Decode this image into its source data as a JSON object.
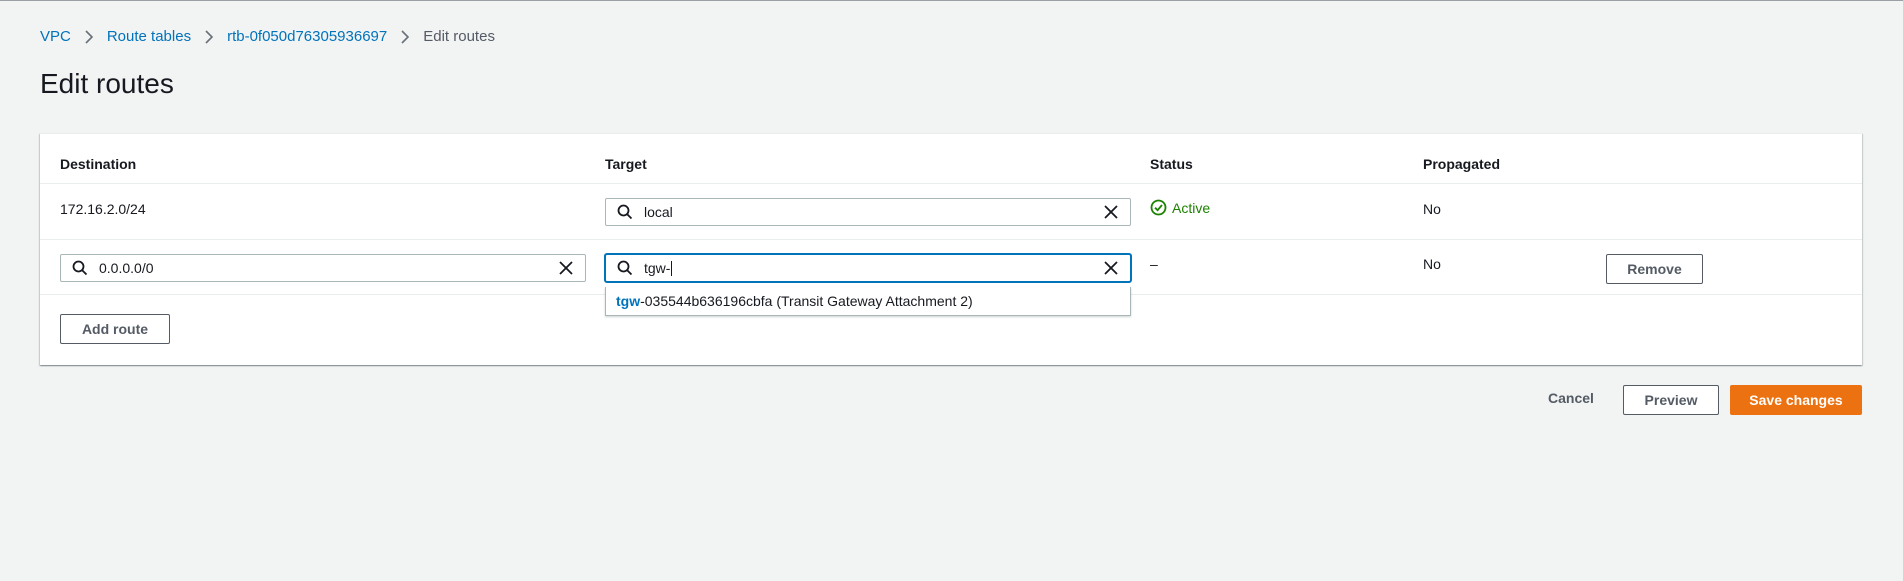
{
  "breadcrumb": {
    "items": [
      "VPC",
      "Route tables",
      "rtb-0f050d76305936697"
    ],
    "current": "Edit routes"
  },
  "page": {
    "title": "Edit routes"
  },
  "table": {
    "headers": {
      "destination": "Destination",
      "target": "Target",
      "status": "Status",
      "propagated": "Propagated"
    },
    "rows": [
      {
        "destination": "172.16.2.0/24",
        "target": "local",
        "status": "Active",
        "propagated": "No"
      },
      {
        "destination": "0.0.0.0/0",
        "target": "tgw-",
        "status": "–",
        "propagated": "No",
        "remove_label": "Remove"
      }
    ]
  },
  "dropdown": {
    "match": "tgw",
    "rest": "-035544b636196cbfa (Transit Gateway Attachment 2)"
  },
  "buttons": {
    "add_route": "Add route",
    "cancel": "Cancel",
    "preview": "Preview",
    "save": "Save changes"
  },
  "colors": {
    "link": "#0073bb",
    "primary": "#ec7211",
    "success": "#1d8102",
    "background": "#f2f3f3"
  }
}
